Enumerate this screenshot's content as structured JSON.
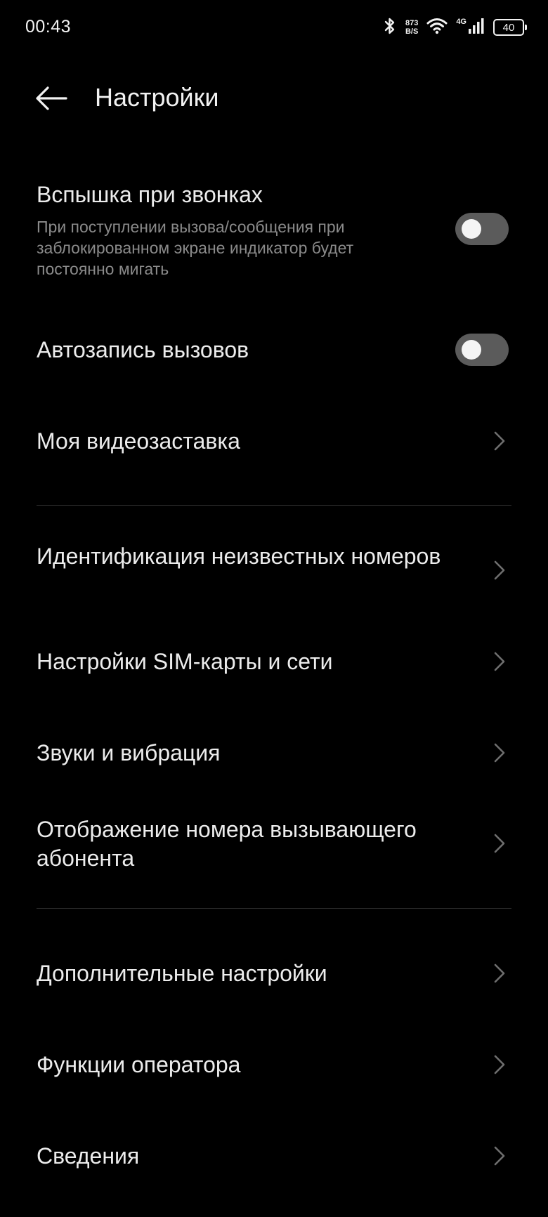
{
  "status_bar": {
    "time": "00:43",
    "speed_value": "873",
    "speed_unit": "B/S",
    "network_type": "4G",
    "battery": "40",
    "icons": [
      "bluetooth-icon",
      "wifi-icon",
      "signal-icon",
      "battery-icon"
    ]
  },
  "header": {
    "title": "Настройки",
    "back_icon": "arrow-left-icon"
  },
  "settings": {
    "flash": {
      "title": "Вспышка при звонках",
      "subtitle": "При поступлении вызова/сообщения при заблокированном экране индикатор будет постоянно мигать",
      "enabled": false
    },
    "autorecord": {
      "title": "Автозапись вызовов",
      "enabled": false
    },
    "video_screensaver": {
      "title": "Моя видеозаставка"
    },
    "unknown_id": {
      "title": "Идентификация неизвестных номеров"
    },
    "sim_settings": {
      "title": "Настройки SIM-карты и сети"
    },
    "sounds": {
      "title": "Звуки и вибрация"
    },
    "caller_id": {
      "title": "Отображение номера вызывающего абонента"
    },
    "advanced": {
      "title": "Дополнительные настройки"
    },
    "operator": {
      "title": "Функции оператора"
    },
    "about": {
      "title": "Сведения"
    }
  },
  "colors": {
    "background": "#000000",
    "text": "#ececec",
    "subtext": "#8a8a8a",
    "toggle_off": "#5b5b5b",
    "divider": "#2e2e2e"
  }
}
